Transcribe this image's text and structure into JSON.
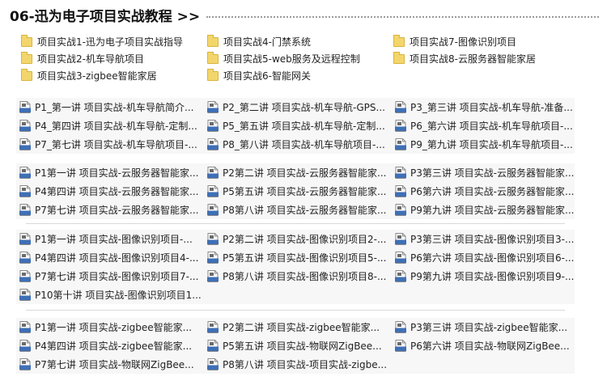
{
  "header": {
    "title": "06-迅为电子项目实战教程 >>"
  },
  "folders": [
    "项目实战1-迅为电子项目实战指导",
    "项目实战2-机车导航项目",
    "项目实战3-zigbee智能家居",
    "项目实战4-门禁系统",
    "项目实战5-web服务及远程控制",
    "项目实战6-智能网关",
    "项目实战7-图像识别项目",
    "项目实战8-云服务器智能家居"
  ],
  "groups": [
    {
      "files": [
        "P1_第一讲 项目实战-机车导航简介...",
        "P2_第二讲 项目实战-机车导航-GPS...",
        "P3_第三讲 项目实战-机车导航-准备...",
        "P4_第四讲 项目实战-机车导航-定制...",
        "P5_第五讲 项目实战-机车导航-定制...",
        "P6_第六讲 项目实战-机车导航项目-...",
        "P7_第七讲 项目实战-机车导航项目-...",
        "P8_第八讲 项目实战-机车导航项目-...",
        "P9_第九讲 项目实战-机车导航项目-..."
      ]
    },
    {
      "files": [
        "P1第一讲 项目实战-云服务器智能家...",
        "P2第二讲 项目实战-云服务器智能家...",
        "P3第三讲 项目实战-云服务器智能家...",
        "P4第四讲 项目实战-云服务器智能家...",
        "P5第五讲 项目实战-云服务器智能家...",
        "P6第六讲 项目实战-云服务器智能家...",
        "P7第七讲 项目实战-云服务器智能家...",
        "P8第八讲 项目实战-云服务器智能家...",
        "P9第九讲 项目实战-云服务器智能家..."
      ]
    },
    {
      "files": [
        "P1第一讲 项目实战-图像识别项目-...",
        "P2第二讲 项目实战-图像识别项目2-...",
        "P3第三讲 项目实战-图像识别项目3-...",
        "P4第四讲 项目实战-图像识别项目4-...",
        "P5第五讲 项目实战-图像识别项目5-...",
        "P6第六讲 项目实战-图像识别项目6-...",
        "P7第七讲 项目实战-图像识别项目7-...",
        "P8第八讲 项目实战-图像识别项目8-...",
        "P9第九讲 项目实战-图像识别项目9-...",
        "P10第十讲 项目实战-图像识别项目1..."
      ]
    },
    {
      "files": [
        "P1第一讲 项目实战-zigbee智能家...",
        "P2第二讲 项目实战-zigbee智能家...",
        "P3第三讲 项目实战-zigbee智能家...",
        "P4第四讲 项目实战-zigbee智能家...",
        "P5第五讲 项目实战-物联网ZigBee...",
        "P6第六讲 项目实战-物联网ZigBee...",
        "P7第七讲 项目实战-物联网ZigBee...",
        "P8第八讲 项目实战-项目实战-zigbe..."
      ]
    }
  ],
  "icons": {
    "folder": "folder-icon",
    "video": "mp4-video-file-icon"
  },
  "colors": {
    "folder": "#f3d66b",
    "video_badge": "#3f6fb5",
    "group_bg": "#f7f7f7"
  }
}
